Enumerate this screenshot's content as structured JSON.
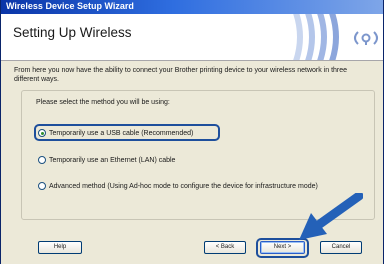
{
  "window": {
    "title": "Wireless Device Setup Wizard",
    "heading": "Setting Up Wireless"
  },
  "intro_text": "From here you now have the ability to connect your Brother printing device to your wireless network in three different ways.",
  "prompt": "Please select the method you will be using:",
  "options": [
    {
      "label": "Temporarily use a USB cable (Recommended)",
      "selected": true
    },
    {
      "label": "Temporarily use an Ethernet (LAN) cable",
      "selected": false
    },
    {
      "label": "Advanced method (Using Ad-hoc mode to configure the device for infrastructure mode)",
      "selected": false
    }
  ],
  "buttons": {
    "help": "Help",
    "back": "< Back",
    "next": "Next >",
    "cancel": "Cancel"
  },
  "colors": {
    "titlebar": "#2f6ee0",
    "highlight": "#1e4f9c",
    "arrow": "#2461b8",
    "logo": "#7c96cc"
  },
  "icons": {
    "logo": "wireless-waves-icon",
    "arrow": "pointing-arrow-icon"
  }
}
